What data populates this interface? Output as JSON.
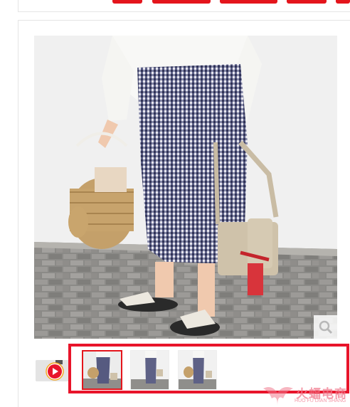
{
  "product_gallery": {
    "main_image_alt": "",
    "zoom_icon": "magnifier-icon",
    "video_icon": "play-icon",
    "thumbnails": [
      "",
      "",
      ""
    ]
  },
  "watermark": {
    "text": "火蝠电商",
    "subtext": "HUO FU DIAN SHANG"
  },
  "colors": {
    "accent": "#e4151c",
    "highlight": "#e8142a"
  }
}
